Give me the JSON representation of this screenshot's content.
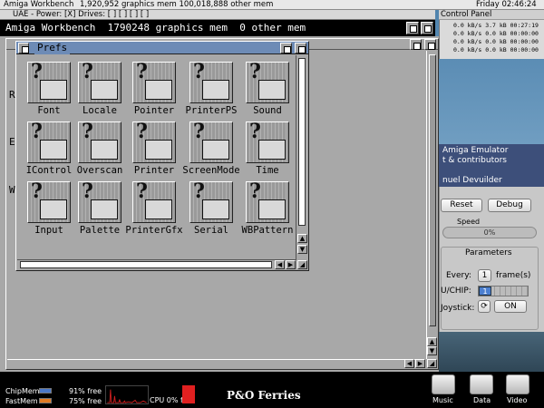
{
  "host": {
    "app_title": "Amiga Workbench",
    "memory_status": "1,920,952 graphics mem   100,018,888 other mem",
    "clock": "Friday 02:46:24"
  },
  "uae_window": {
    "title": "UAE - Power: [X] Drives: [ ] [ ] [ ] [ ]"
  },
  "amiga_screen": {
    "title": "Amiga Workbench  1790248 graphics mem  0 other mem"
  },
  "background_letters": [
    "R",
    "E",
    "W"
  ],
  "prefs": {
    "title": "Prefs",
    "icons": [
      {
        "label": "Font"
      },
      {
        "label": "Locale"
      },
      {
        "label": "Pointer"
      },
      {
        "label": "PrinterPS"
      },
      {
        "label": "Sound"
      },
      {
        "label": "IControl"
      },
      {
        "label": "Overscan"
      },
      {
        "label": "Printer"
      },
      {
        "label": "ScreenMode"
      },
      {
        "label": "Time"
      },
      {
        "label": "Input"
      },
      {
        "label": "Palette"
      },
      {
        "label": "PrinterGfx"
      },
      {
        "label": "Serial"
      },
      {
        "label": "WBPattern"
      }
    ]
  },
  "control_panel": {
    "title": "Control Panel",
    "rows": [
      "0.0 kB/s      3.7 kB 00:27:19",
      "0.0 kB/s      0.0 kB 00:00:00",
      "0.0 kB/s      0.0 kB 00:00:00",
      "0.0 kB/s      0.0 kB 00:00:00"
    ]
  },
  "emulator": {
    "header_lines": [
      "Amiga Emulator",
      "t & contributors",
      "",
      "nuel Devuilder"
    ],
    "reset_label": "Reset",
    "debug_label": "Debug",
    "speed_label": "Speed",
    "speed_value": "0%",
    "parameters_label": "Parameters",
    "every_label": "Every:",
    "every_value": "1",
    "frames_label": "frame(s)",
    "cpu_chip_label": "U/CHIP:",
    "cpu_chip_value": "1",
    "joystick_label": "Joystick:",
    "on_label": "ON"
  },
  "dock": {
    "chipmem_label": "ChipMem",
    "chipmem_free": "91% free",
    "fastmem_label": "FastMem",
    "fastmem_free": "75% free",
    "cpu_label": "CPU 0% free",
    "ferries_text": "P&O Ferries",
    "items": [
      {
        "label": "Music"
      },
      {
        "label": "Data"
      },
      {
        "label": "Video"
      }
    ]
  },
  "colors": {
    "prefs_title_bar": "#6d8bb6",
    "workbench_grey": "#a8a8a8",
    "chipmem_bar": "#4a78c8",
    "fastmem_bar": "#e07b25",
    "graph_red": "#d22020",
    "emulator_strip": "#3d4f7a"
  }
}
